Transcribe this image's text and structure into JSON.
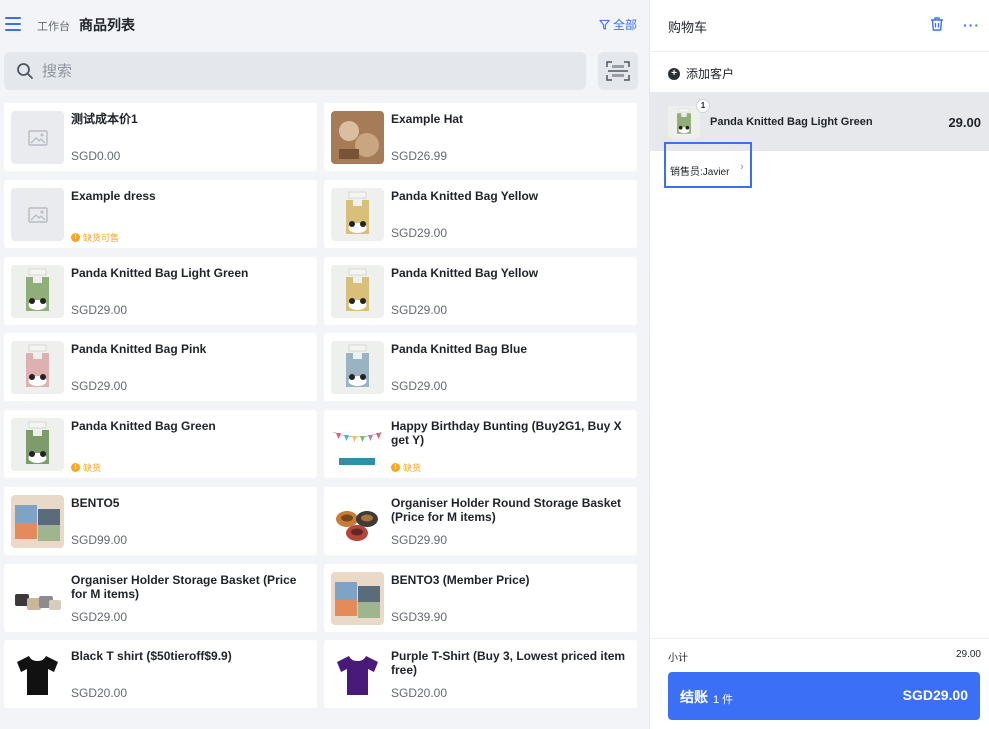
{
  "header": {
    "breadcrumb_home": "工作台",
    "title": "商品列表",
    "filter_label": "全部"
  },
  "search": {
    "placeholder": "搜索"
  },
  "products": [
    {
      "name": "测试成本价1",
      "price": "SGD0.00",
      "stock": "",
      "thumb": "placeholder"
    },
    {
      "name": "Example Hat",
      "price": "SGD26.99",
      "stock": "",
      "thumb": "hat"
    },
    {
      "name": "Example dress",
      "price": "",
      "stock": "缺货可售",
      "thumb": "placeholder"
    },
    {
      "name": "Panda Knitted Bag Yellow",
      "price": "SGD29.00",
      "stock": "",
      "thumb": "bag-yellow"
    },
    {
      "name": "Panda Knitted Bag Light Green",
      "price": "SGD29.00",
      "stock": "",
      "thumb": "bag-lightgreen"
    },
    {
      "name": "Panda Knitted Bag Yellow",
      "price": "SGD29.00",
      "stock": "",
      "thumb": "bag-yellow"
    },
    {
      "name": "Panda Knitted Bag Pink",
      "price": "SGD29.00",
      "stock": "",
      "thumb": "bag-pink"
    },
    {
      "name": "Panda Knitted Bag Blue",
      "price": "SGD29.00",
      "stock": "",
      "thumb": "bag-blue"
    },
    {
      "name": "Panda Knitted Bag Green",
      "price": "",
      "stock": "缺货",
      "thumb": "bag-green"
    },
    {
      "name": "Happy Birthday Bunting (Buy2G1, Buy X get Y)",
      "price": "",
      "stock": "缺货",
      "thumb": "bunting"
    },
    {
      "name": "BENTO5",
      "price": "SGD99.00",
      "stock": "",
      "thumb": "bento"
    },
    {
      "name": "Organiser Holder Round Storage Basket (Price for M items)",
      "price": "SGD29.90",
      "stock": "",
      "thumb": "bowls"
    },
    {
      "name": "Organiser Holder Storage Basket (Price for M items)",
      "price": "SGD29.00",
      "stock": "",
      "thumb": "baskets"
    },
    {
      "name": "BENTO3 (Member Price)",
      "price": "SGD39.90",
      "stock": "",
      "thumb": "bento"
    },
    {
      "name": "Black T shirt ($50tieroff$9.9)",
      "price": "SGD20.00",
      "stock": "",
      "thumb": "tshirt-black"
    },
    {
      "name": "Purple T-Shirt (Buy 3, Lowest priced item free)",
      "price": "SGD20.00",
      "stock": "",
      "thumb": "tshirt-purple"
    }
  ],
  "cart": {
    "title": "购物车",
    "add_customer": "添加客户",
    "line": {
      "qty": "1",
      "name": "Panda Knitted Bag Light Green",
      "price": "29.00"
    },
    "salesperson": "销售员:Javier",
    "subtotal_label": "小计",
    "subtotal_value": "29.00",
    "checkout_label": "结账",
    "checkout_count": "1 件",
    "checkout_total": "SGD29.00"
  },
  "colors": {
    "accent": "#3b6ff5",
    "warning": "#f5a623"
  }
}
